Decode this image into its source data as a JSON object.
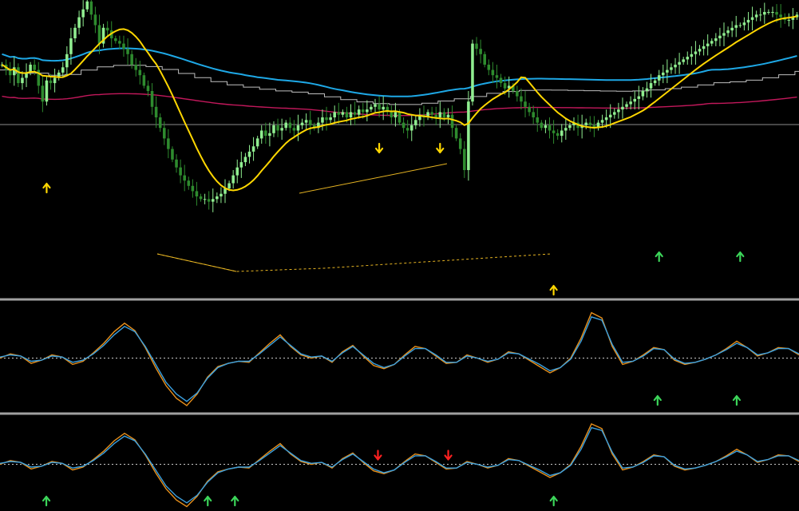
{
  "colors": {
    "background": "#000000",
    "bull_candle": "#90ee90",
    "bear_candle": "#2e8b2e",
    "ma_fast": "#ffd700",
    "ma_slow": "#1ea8e6",
    "ma_maroon": "#c2185b",
    "step_line": "#bfbfbf",
    "level_line": "#8c8c8c",
    "divergence_line": "#e6b422",
    "arrow_yellow": "#ffd700",
    "arrow_green": "#3cd65a",
    "arrow_red": "#ff2020",
    "osc_orange": "#e8901c",
    "osc_blue": "#3aa0e0",
    "separator": "#a0a0a0"
  },
  "chart_data": [
    {
      "type": "candlestick",
      "panel": "price",
      "grid": false,
      "ylim": [
        0,
        100
      ],
      "bars": 197,
      "close_series": [
        80,
        78,
        76,
        79,
        73,
        75,
        77,
        80,
        78,
        72,
        66,
        74,
        73,
        75,
        77,
        79,
        84,
        90,
        94,
        98,
        101,
        104,
        99,
        95,
        88,
        94,
        93,
        90,
        89,
        88,
        86,
        84,
        80,
        78,
        76,
        72,
        70,
        64,
        60,
        56,
        52,
        48,
        44,
        41,
        38,
        36,
        34,
        32,
        30,
        29,
        29,
        28,
        29,
        30,
        31,
        33,
        35,
        38,
        41,
        43,
        45,
        47,
        49,
        52,
        55,
        53,
        54,
        57,
        55,
        56,
        58,
        56,
        55,
        57,
        58,
        59,
        57,
        56,
        58,
        60,
        59,
        60,
        62,
        61,
        62,
        60,
        62,
        61,
        63,
        62,
        63,
        64,
        65,
        63,
        64,
        62,
        60,
        62,
        58,
        56,
        55,
        57,
        59,
        61,
        60,
        62,
        61,
        60,
        62,
        60,
        61,
        56,
        52,
        48,
        40,
        66,
        88,
        86,
        84,
        80,
        78,
        76,
        75,
        73,
        71,
        72,
        70,
        68,
        66,
        64,
        62,
        60,
        58,
        56,
        57,
        55,
        54,
        53,
        55,
        56,
        57,
        58,
        56,
        57,
        58,
        57,
        56,
        58,
        59,
        60,
        61,
        62,
        63,
        64,
        65,
        66,
        67,
        68,
        70,
        71,
        73,
        74,
        76,
        77,
        78,
        79,
        80,
        81,
        82,
        83,
        84,
        85,
        86,
        87,
        88,
        89,
        90,
        91,
        92,
        93,
        94,
        95,
        95,
        96,
        97,
        98,
        99,
        99,
        100,
        100,
        100,
        99,
        98,
        97,
        97,
        98,
        99
      ],
      "moving_averages": [
        {
          "color": "ma_fast",
          "kind": "fast"
        },
        {
          "color": "ma_slow",
          "kind": "slow"
        },
        {
          "color": "ma_maroon",
          "kind": "flat"
        },
        {
          "color": "step_line",
          "kind": "step"
        }
      ],
      "markers": [
        {
          "bar": 11,
          "dir": "up",
          "color": "arrow_yellow"
        },
        {
          "bar": 93,
          "dir": "down",
          "color": "arrow_yellow"
        },
        {
          "bar": 108,
          "dir": "down",
          "color": "arrow_yellow"
        },
        {
          "bar": 136,
          "dir": "up",
          "color": "arrow_yellow"
        },
        {
          "bar": 162,
          "dir": "up",
          "color": "arrow_green"
        },
        {
          "bar": 182,
          "dir": "up",
          "color": "arrow_green"
        }
      ]
    },
    {
      "type": "line",
      "panel": "oscillator_1",
      "grid": false,
      "zero_line": true,
      "series": [
        {
          "color": "osc_orange",
          "values": [
            0.0,
            0.4,
            0.2,
            -0.5,
            -0.2,
            0.3,
            0.1,
            -0.6,
            -0.3,
            0.5,
            1.4,
            2.5,
            3.3,
            2.6,
            1.0,
            -0.9,
            -2.6,
            -3.8,
            -4.5,
            -3.4,
            -1.8,
            -0.8,
            -0.5,
            -0.3,
            -0.4,
            0.5,
            1.4,
            2.2,
            1.1,
            0.3,
            0.0,
            0.2,
            -0.4,
            0.6,
            1.2,
            0.2,
            -0.7,
            -1.0,
            -0.6,
            0.3,
            1.1,
            0.9,
            0.2,
            -0.5,
            -0.4,
            0.3,
            0.0,
            -0.4,
            -0.1,
            0.6,
            0.4,
            -0.2,
            -0.8,
            -1.4,
            -0.9,
            0.0,
            1.9,
            4.3,
            3.8,
            1.1,
            -0.6,
            -0.3,
            0.3,
            1.0,
            0.8,
            -0.2,
            -0.6,
            -0.4,
            -0.1,
            0.3,
            0.9,
            1.6,
            1.0,
            0.2,
            0.5,
            1.0,
            0.9,
            0.3
          ]
        },
        {
          "color": "osc_blue",
          "values": [
            0.1,
            0.3,
            0.2,
            -0.3,
            -0.2,
            0.2,
            0.1,
            -0.4,
            -0.2,
            0.4,
            1.2,
            2.2,
            3.0,
            2.5,
            1.1,
            -0.6,
            -2.3,
            -3.4,
            -4.1,
            -3.3,
            -1.9,
            -0.9,
            -0.5,
            -0.3,
            -0.3,
            0.4,
            1.2,
            2.0,
            1.2,
            0.4,
            0.1,
            0.2,
            -0.3,
            0.5,
            1.1,
            0.3,
            -0.5,
            -0.9,
            -0.6,
            0.2,
            0.9,
            0.9,
            0.3,
            -0.4,
            -0.4,
            0.2,
            0.0,
            -0.3,
            -0.1,
            0.5,
            0.4,
            -0.1,
            -0.6,
            -1.2,
            -0.9,
            -0.1,
            1.6,
            3.9,
            3.6,
            1.3,
            -0.4,
            -0.3,
            0.2,
            0.9,
            0.8,
            -0.1,
            -0.5,
            -0.4,
            -0.1,
            0.3,
            0.8,
            1.4,
            1.0,
            0.3,
            0.5,
            0.9,
            0.9,
            0.4
          ]
        }
      ],
      "markers": [
        {
          "pos": 0.823,
          "dir": "up",
          "color": "arrow_green"
        },
        {
          "pos": 0.922,
          "dir": "up",
          "color": "arrow_green"
        }
      ]
    },
    {
      "type": "line",
      "panel": "oscillator_2",
      "grid": false,
      "zero_line": true,
      "series": [
        {
          "color": "osc_orange",
          "values": [
            0.0,
            0.4,
            0.2,
            -0.5,
            -0.2,
            0.3,
            0.1,
            -0.6,
            -0.3,
            0.5,
            1.4,
            2.5,
            3.3,
            2.6,
            1.0,
            -0.9,
            -2.6,
            -3.8,
            -4.5,
            -3.4,
            -1.8,
            -0.8,
            -0.5,
            -0.3,
            -0.4,
            0.5,
            1.4,
            2.2,
            1.1,
            0.3,
            0.0,
            0.2,
            -0.4,
            0.6,
            1.2,
            0.2,
            -0.7,
            -1.0,
            -0.6,
            0.3,
            1.1,
            0.9,
            0.2,
            -0.5,
            -0.4,
            0.3,
            0.0,
            -0.4,
            -0.1,
            0.6,
            0.4,
            -0.2,
            -0.8,
            -1.4,
            -0.9,
            0.0,
            1.9,
            4.3,
            3.8,
            1.1,
            -0.6,
            -0.3,
            0.3,
            1.0,
            0.8,
            -0.2,
            -0.6,
            -0.4,
            -0.1,
            0.3,
            0.9,
            1.6,
            1.0,
            0.2,
            0.5,
            1.0,
            0.9,
            0.3
          ]
        },
        {
          "color": "osc_blue",
          "values": [
            0.1,
            0.3,
            0.2,
            -0.3,
            -0.2,
            0.2,
            0.1,
            -0.4,
            -0.2,
            0.4,
            1.2,
            2.2,
            3.0,
            2.5,
            1.1,
            -0.6,
            -2.3,
            -3.4,
            -4.1,
            -3.3,
            -1.9,
            -0.9,
            -0.5,
            -0.3,
            -0.3,
            0.4,
            1.2,
            2.0,
            1.2,
            0.4,
            0.1,
            0.2,
            -0.3,
            0.5,
            1.1,
            0.3,
            -0.5,
            -0.9,
            -0.6,
            0.2,
            0.9,
            0.9,
            0.3,
            -0.4,
            -0.4,
            0.2,
            0.0,
            -0.3,
            -0.1,
            0.5,
            0.4,
            -0.1,
            -0.6,
            -1.2,
            -0.9,
            -0.1,
            1.6,
            3.9,
            3.6,
            1.3,
            -0.4,
            -0.3,
            0.2,
            0.9,
            0.8,
            -0.1,
            -0.5,
            -0.4,
            -0.1,
            0.3,
            0.8,
            1.4,
            1.0,
            0.3,
            0.5,
            0.9,
            0.9,
            0.4
          ]
        }
      ],
      "markers": [
        {
          "pos": 0.058,
          "dir": "up",
          "color": "arrow_green"
        },
        {
          "pos": 0.26,
          "dir": "up",
          "color": "arrow_green"
        },
        {
          "pos": 0.294,
          "dir": "up",
          "color": "arrow_green"
        },
        {
          "pos": 0.473,
          "dir": "down",
          "color": "arrow_red"
        },
        {
          "pos": 0.561,
          "dir": "down",
          "color": "arrow_red"
        },
        {
          "pos": 0.693,
          "dir": "up",
          "color": "arrow_green"
        }
      ]
    }
  ]
}
